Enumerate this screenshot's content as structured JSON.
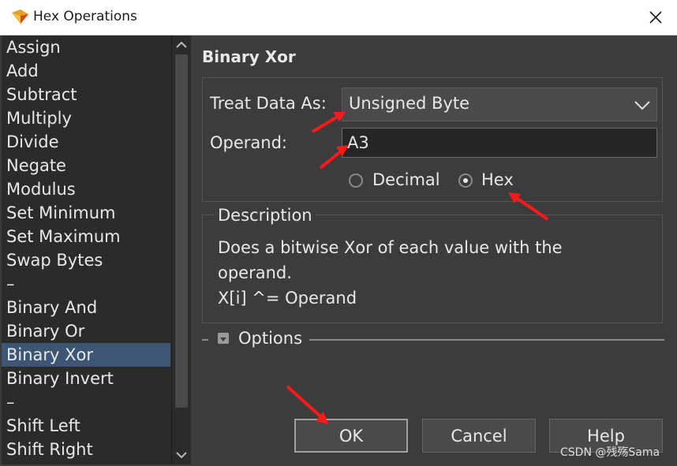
{
  "window": {
    "title": "Hex Operations",
    "app_icon": "hex-app-icon"
  },
  "list": {
    "items": [
      {
        "label": "Assign"
      },
      {
        "label": "Add"
      },
      {
        "label": "Subtract"
      },
      {
        "label": "Multiply"
      },
      {
        "label": "Divide"
      },
      {
        "label": "Negate"
      },
      {
        "label": "Modulus"
      },
      {
        "label": "Set Minimum"
      },
      {
        "label": "Set Maximum"
      },
      {
        "label": "Swap Bytes"
      },
      {
        "label": "–"
      },
      {
        "label": "Binary And"
      },
      {
        "label": "Binary Or"
      },
      {
        "label": "Binary Xor"
      },
      {
        "label": "Binary Invert"
      },
      {
        "label": "–"
      },
      {
        "label": "Shift Left"
      },
      {
        "label": "Shift Right"
      }
    ],
    "selected": "Binary Xor"
  },
  "panel": {
    "title": "Binary Xor",
    "treat_label": "Treat Data As:",
    "treat_value": "Unsigned Byte",
    "operand_label": "Operand:",
    "operand_value": "A3",
    "radio_decimal": "Decimal",
    "radio_hex": "Hex",
    "radio_selected": "Hex"
  },
  "description": {
    "title": "Description",
    "lines": [
      "Does a bitwise Xor of each value with the",
      "operand.",
      "X[i] ^= Operand"
    ]
  },
  "options": {
    "label": "Options"
  },
  "buttons": {
    "ok": "OK",
    "cancel": "Cancel",
    "help": "Help"
  },
  "watermark": "CSDN @残殇Sama",
  "colors": {
    "selection": "#3d5673",
    "annotation_arrow": "#ff0000",
    "background": "#3c3c3c"
  }
}
